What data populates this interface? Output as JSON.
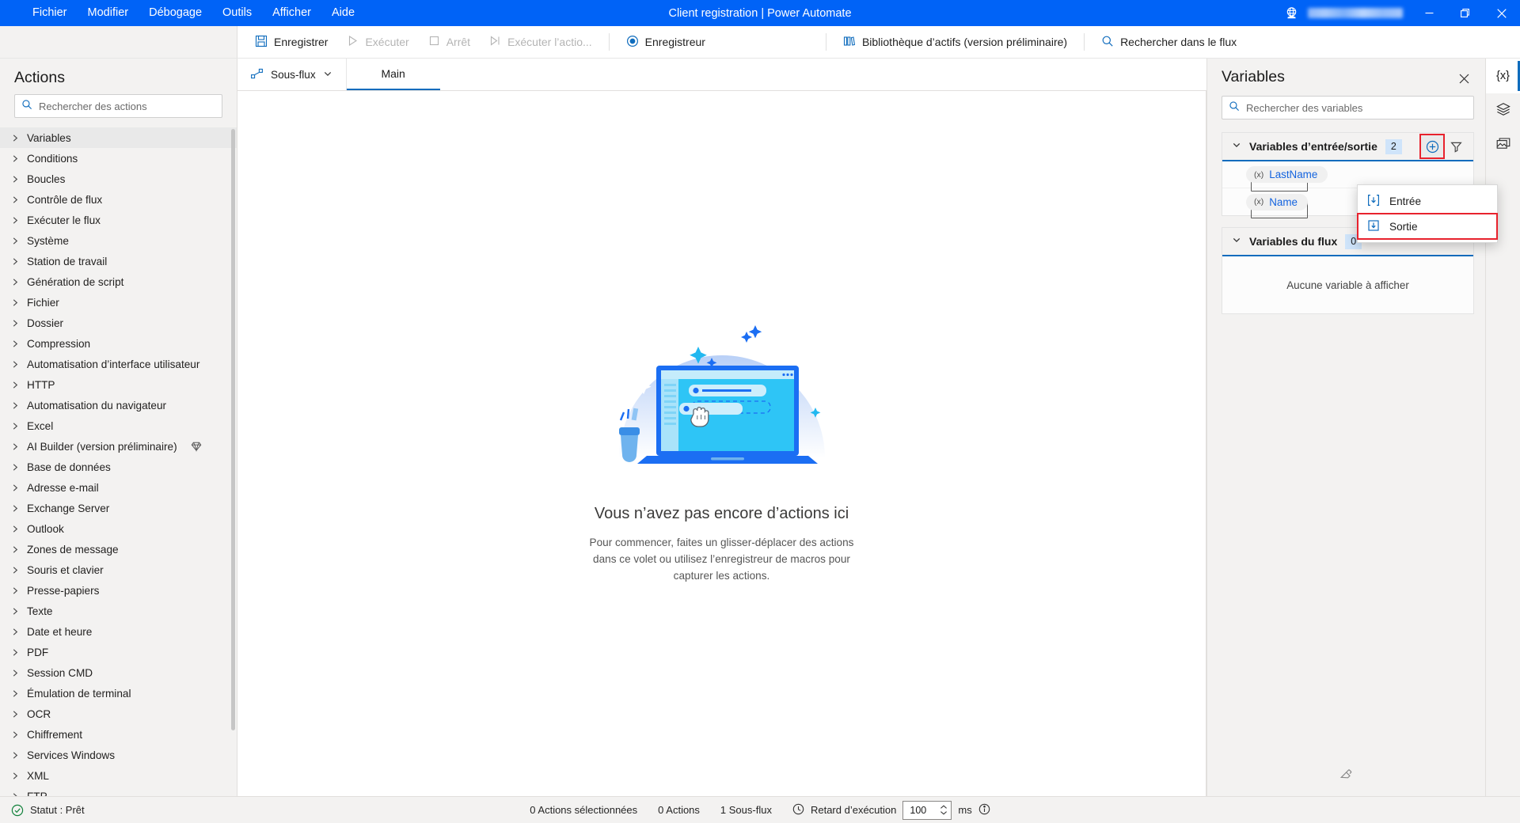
{
  "window": {
    "title": "Client registration | Power Automate",
    "menu": [
      "Fichier",
      "Modifier",
      "Débogage",
      "Outils",
      "Afficher",
      "Aide"
    ],
    "globe_icon": "globe-icon",
    "minimize_label": "—",
    "restore_label": "❐",
    "close_label": "✕",
    "accent": "#0063f7"
  },
  "toolbar": {
    "save": "Enregistrer",
    "run": "Exécuter",
    "stop": "Arrêt",
    "run_action": "Exécuter l’actio...",
    "recorder": "Enregistreur",
    "asset_library": "Bibliothèque d’actifs (version préliminaire)",
    "search_flow": "Rechercher dans le flux"
  },
  "actions_pane": {
    "title": "Actions",
    "search_placeholder": "Rechercher des actions",
    "items": [
      {
        "label": "Variables",
        "selected": true,
        "premium": false
      },
      {
        "label": "Conditions",
        "selected": false,
        "premium": false
      },
      {
        "label": "Boucles",
        "selected": false,
        "premium": false
      },
      {
        "label": "Contrôle de flux",
        "selected": false,
        "premium": false
      },
      {
        "label": "Exécuter le flux",
        "selected": false,
        "premium": false
      },
      {
        "label": "Système",
        "selected": false,
        "premium": false
      },
      {
        "label": "Station de travail",
        "selected": false,
        "premium": false
      },
      {
        "label": "Génération de script",
        "selected": false,
        "premium": false
      },
      {
        "label": "Fichier",
        "selected": false,
        "premium": false
      },
      {
        "label": "Dossier",
        "selected": false,
        "premium": false
      },
      {
        "label": "Compression",
        "selected": false,
        "premium": false
      },
      {
        "label": "Automatisation d’interface utilisateur",
        "selected": false,
        "premium": false
      },
      {
        "label": "HTTP",
        "selected": false,
        "premium": false
      },
      {
        "label": "Automatisation du navigateur",
        "selected": false,
        "premium": false
      },
      {
        "label": "Excel",
        "selected": false,
        "premium": false
      },
      {
        "label": "AI Builder (version préliminaire)",
        "selected": false,
        "premium": true
      },
      {
        "label": "Base de données",
        "selected": false,
        "premium": false
      },
      {
        "label": "Adresse e-mail",
        "selected": false,
        "premium": false
      },
      {
        "label": "Exchange Server",
        "selected": false,
        "premium": false
      },
      {
        "label": "Outlook",
        "selected": false,
        "premium": false
      },
      {
        "label": "Zones de message",
        "selected": false,
        "premium": false
      },
      {
        "label": "Souris et clavier",
        "selected": false,
        "premium": false
      },
      {
        "label": "Presse-papiers",
        "selected": false,
        "premium": false
      },
      {
        "label": "Texte",
        "selected": false,
        "premium": false
      },
      {
        "label": "Date et heure",
        "selected": false,
        "premium": false
      },
      {
        "label": "PDF",
        "selected": false,
        "premium": false
      },
      {
        "label": "Session CMD",
        "selected": false,
        "premium": false
      },
      {
        "label": "Émulation de terminal",
        "selected": false,
        "premium": false
      },
      {
        "label": "OCR",
        "selected": false,
        "premium": false
      },
      {
        "label": "Chiffrement",
        "selected": false,
        "premium": false
      },
      {
        "label": "Services Windows",
        "selected": false,
        "premium": false
      },
      {
        "label": "XML",
        "selected": false,
        "premium": false
      },
      {
        "label": "FTP",
        "selected": false,
        "premium": false
      }
    ]
  },
  "canvas": {
    "subflow_tab": "Sous-flux",
    "main_tab": "Main",
    "empty_title": "Vous n’avez pas encore d’actions ici",
    "empty_subtitle": "Pour commencer, faites un glisser-déplacer des actions dans ce volet ou utilisez l’enregistreur de macros pour capturer les actions."
  },
  "variables_pane": {
    "title": "Variables",
    "search_placeholder": "Rechercher des variables",
    "io_group": {
      "title": "Variables d’entrée/sortie",
      "count": "2",
      "add_icon": "plus-circle-icon",
      "filter_icon": "filter-icon",
      "variables": [
        {
          "name": "LastName",
          "type_glyph": "(x)"
        },
        {
          "name": "Name",
          "type_glyph": "(x)"
        }
      ]
    },
    "flow_group": {
      "title": "Variables du flux",
      "count": "0",
      "empty_text": "Aucune variable à afficher"
    },
    "dropdown": {
      "input": "Entrée",
      "output": "Sortie",
      "highlighted": "Sortie"
    },
    "highlight_color": "#e8222d"
  },
  "rail": {
    "variables_icon": "{x}",
    "layers_icon": "layers-icon",
    "images_icon": "images-icon"
  },
  "statusbar": {
    "status": "Statut : Prêt",
    "selected_actions": "0 Actions sélectionnées",
    "actions": "0 Actions",
    "subflows": "1 Sous-flux",
    "delay_label": "Retard d’exécution",
    "delay_value": "100",
    "delay_unit": "ms"
  }
}
